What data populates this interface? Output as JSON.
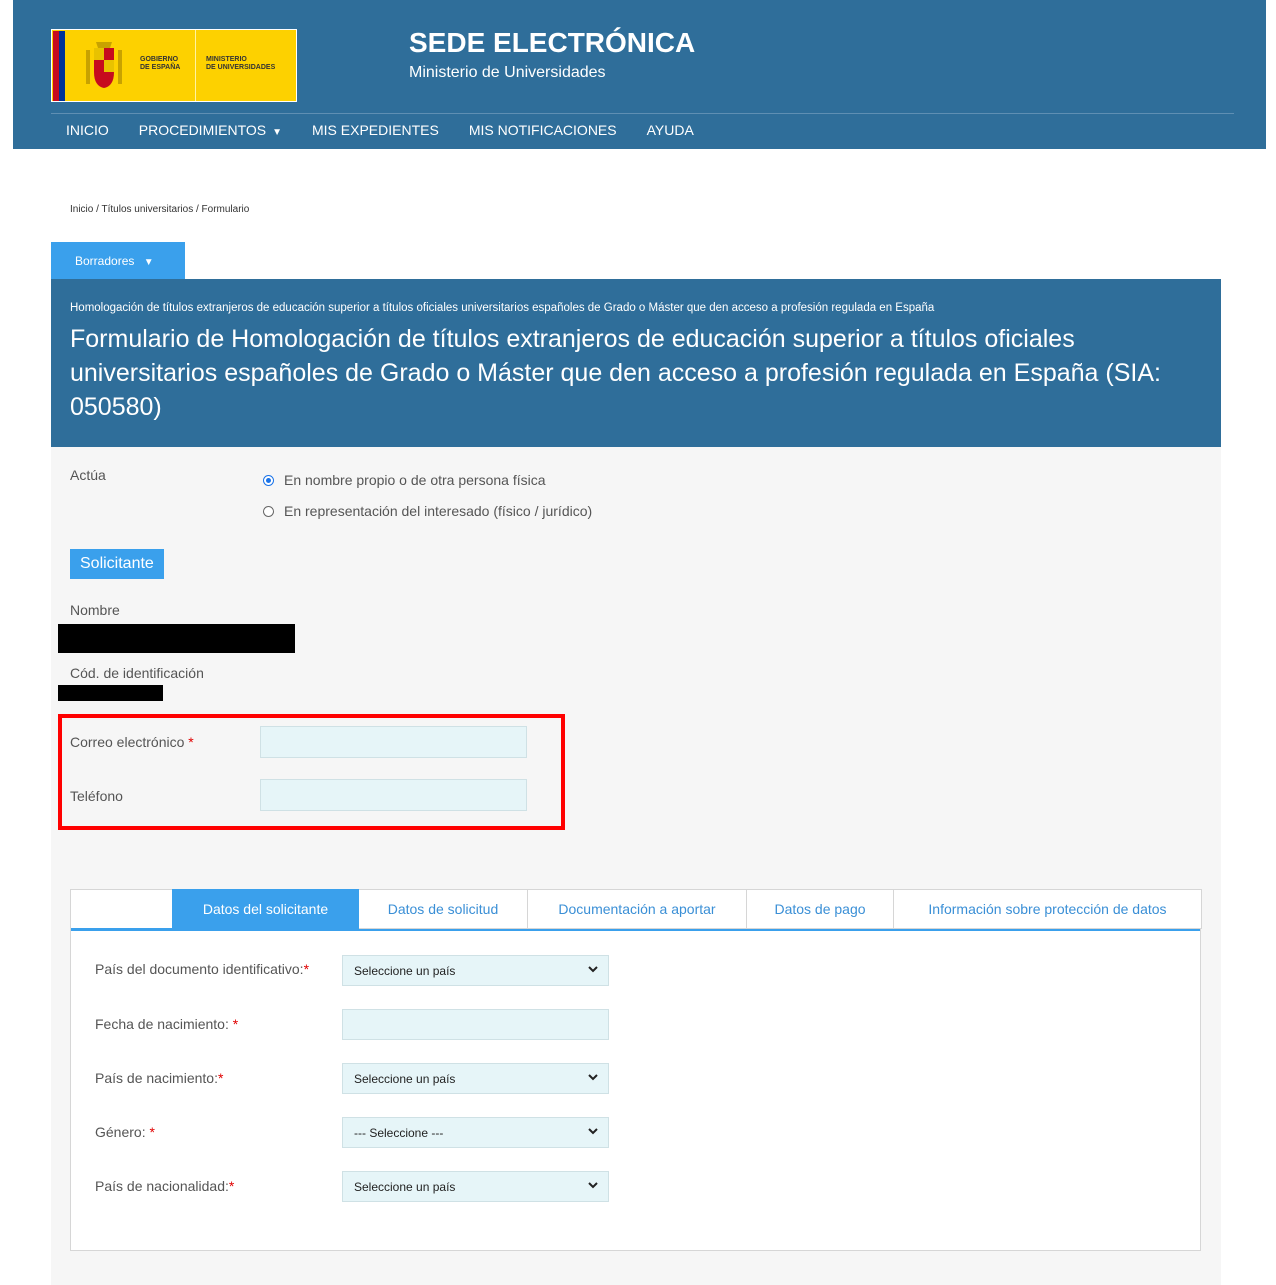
{
  "header": {
    "logo_text_gov": [
      "GOBIERNO",
      "DE ESPAÑA"
    ],
    "logo_text_ministry": [
      "MINISTERIO",
      "DE UNIVERSIDADES"
    ],
    "title": "SEDE ELECTRÓNICA",
    "subtitle": "Ministerio de Universidades"
  },
  "nav": {
    "items": [
      "INICIO",
      "PROCEDIMIENTOS",
      "MIS EXPEDIENTES",
      "MIS NOTIFICACIONES",
      "AYUDA"
    ]
  },
  "breadcrumb": "Inicio / Títulos universitarios / Formulario",
  "drafts": {
    "label": "Borradores"
  },
  "banner": {
    "procedure": "Homologación de títulos extranjeros de educación superior a títulos oficiales universitarios españoles de Grado o Máster que den acceso a profesión regulada en España",
    "title": "Formulario de Homologación de títulos extranjeros de educación superior a títulos oficiales universitarios españoles de Grado o Máster que den acceso a profesión regulada en España (SIA: 050580)"
  },
  "acts": {
    "label": "Actúa",
    "options": [
      "En nombre propio o de otra persona física",
      "En representación del interesado (físico / jurídico)"
    ],
    "selected": 0
  },
  "applicant": {
    "section": "Solicitante",
    "name_label": "Nombre",
    "id_label": "Cód. de identificación",
    "email_label": "Correo electrónico",
    "email_value": "",
    "phone_label": "Teléfono",
    "phone_value": ""
  },
  "tabs": {
    "items": [
      "Datos del solicitante",
      "Datos de solicitud",
      "Documentación a aportar",
      "Datos de pago",
      "Información sobre protección de datos"
    ],
    "active": 0
  },
  "form": {
    "doc_country_label": "País del documento identificativo:",
    "doc_country_value": "Seleccione un país",
    "birth_date_label": "Fecha de nacimiento: ",
    "birth_date_value": "",
    "birth_country_label": "País de nacimiento:",
    "birth_country_value": "Seleccione un país",
    "gender_label": "Género: ",
    "gender_value": "--- Seleccione ---",
    "nationality_label": "País de nacionalidad:",
    "nationality_value": "Seleccione un país"
  },
  "colors": {
    "header_bg": "#2f6e9a",
    "accent": "#3aa0ec",
    "highlight": "#ff0000",
    "input_bg": "#e6f5f8"
  }
}
